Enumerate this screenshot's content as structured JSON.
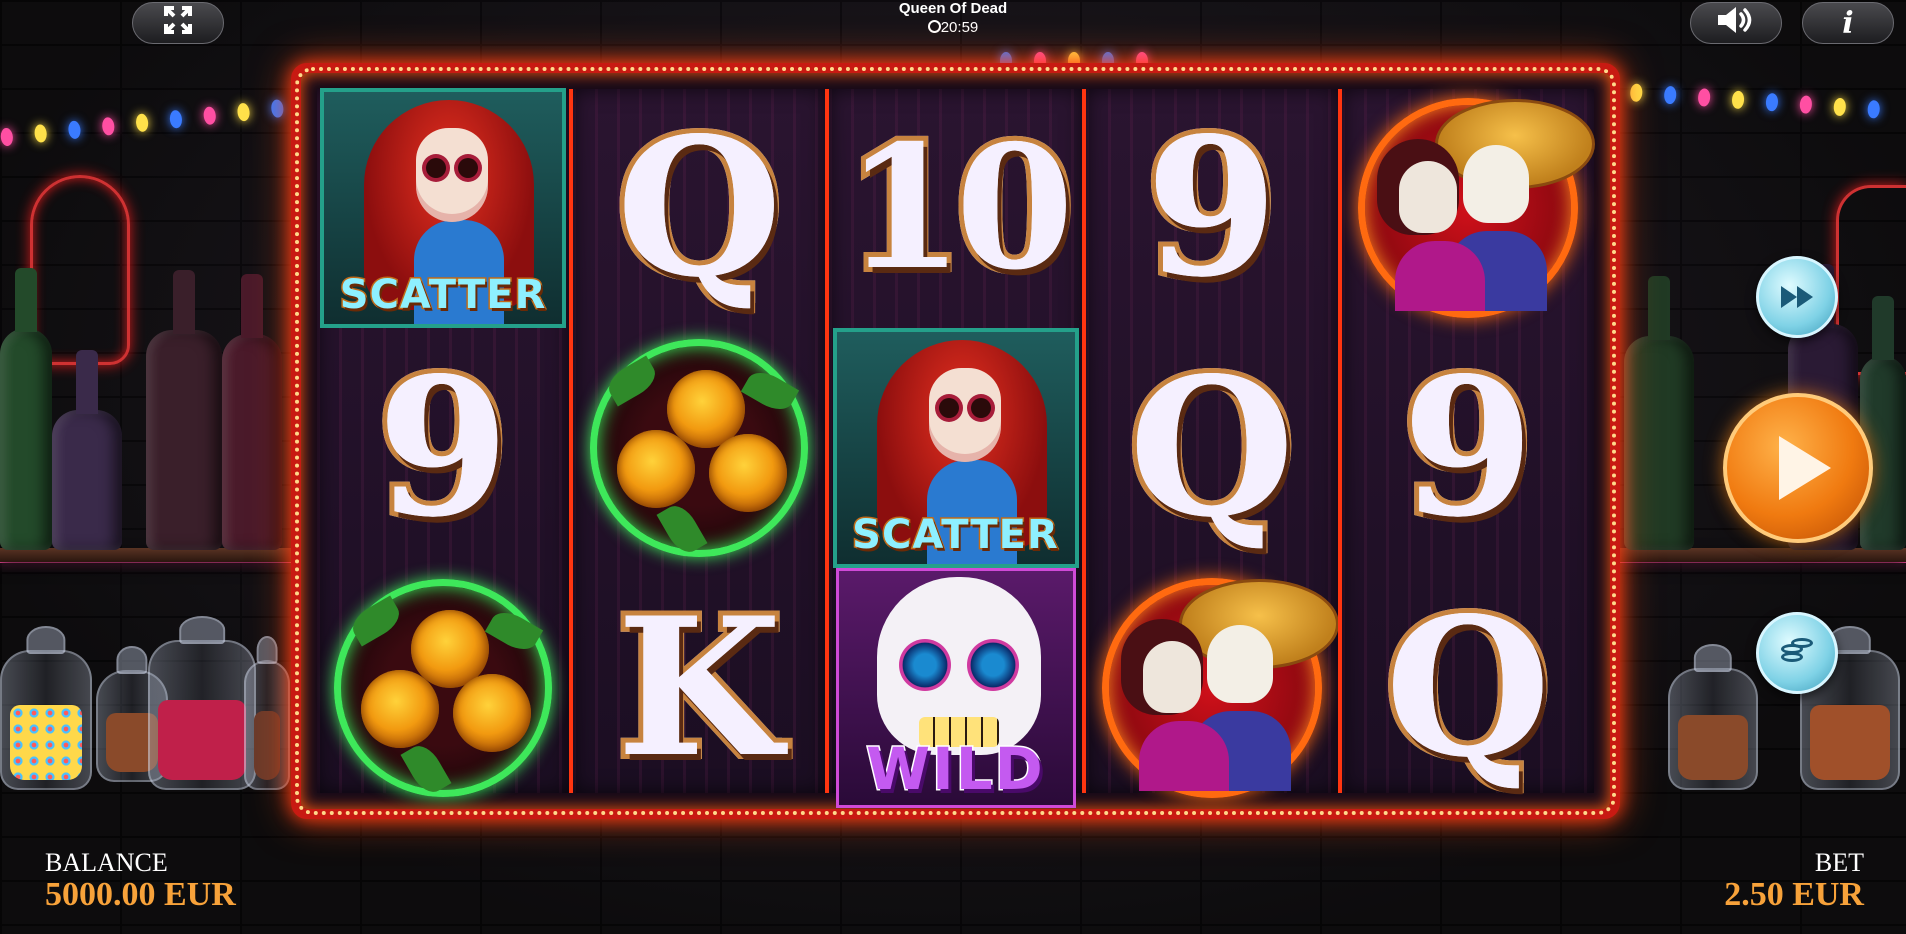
{
  "header": {
    "game_title": "Queen Of Dead",
    "clock_time": "20:59",
    "clock_icon": "clock-icon",
    "fullscreen_icon": "fullscreen-icon",
    "sound_icon": "speaker-icon",
    "info_icon": "info-icon",
    "info_glyph": "i"
  },
  "reels": [
    {
      "symbols": [
        "Scatter",
        "9",
        "Marigold"
      ]
    },
    {
      "symbols": [
        "Q",
        "Marigold",
        "K"
      ]
    },
    {
      "symbols": [
        "10",
        "Scatter",
        "Wild"
      ]
    },
    {
      "symbols": [
        "9",
        "Q",
        "Couple"
      ]
    },
    {
      "symbols": [
        "Couple",
        "9",
        "Q"
      ]
    }
  ],
  "labels": {
    "scatter": "SCATTER",
    "wild": "WILD"
  },
  "controls": {
    "turbo_icon": "fast-forward-icon",
    "spin_icon": "play-icon",
    "bet_icon": "coin-stack-icon"
  },
  "footer": {
    "balance_label": "BALANCE",
    "balance_value": "5000.00 EUR",
    "bet_label": "BET",
    "bet_value": "2.50 EUR"
  },
  "colors": {
    "accent_orange": "#f7a23a",
    "frame_red": "#c81a12",
    "neon_green": "#3ee85a",
    "spin_orange": "#f07a10"
  }
}
